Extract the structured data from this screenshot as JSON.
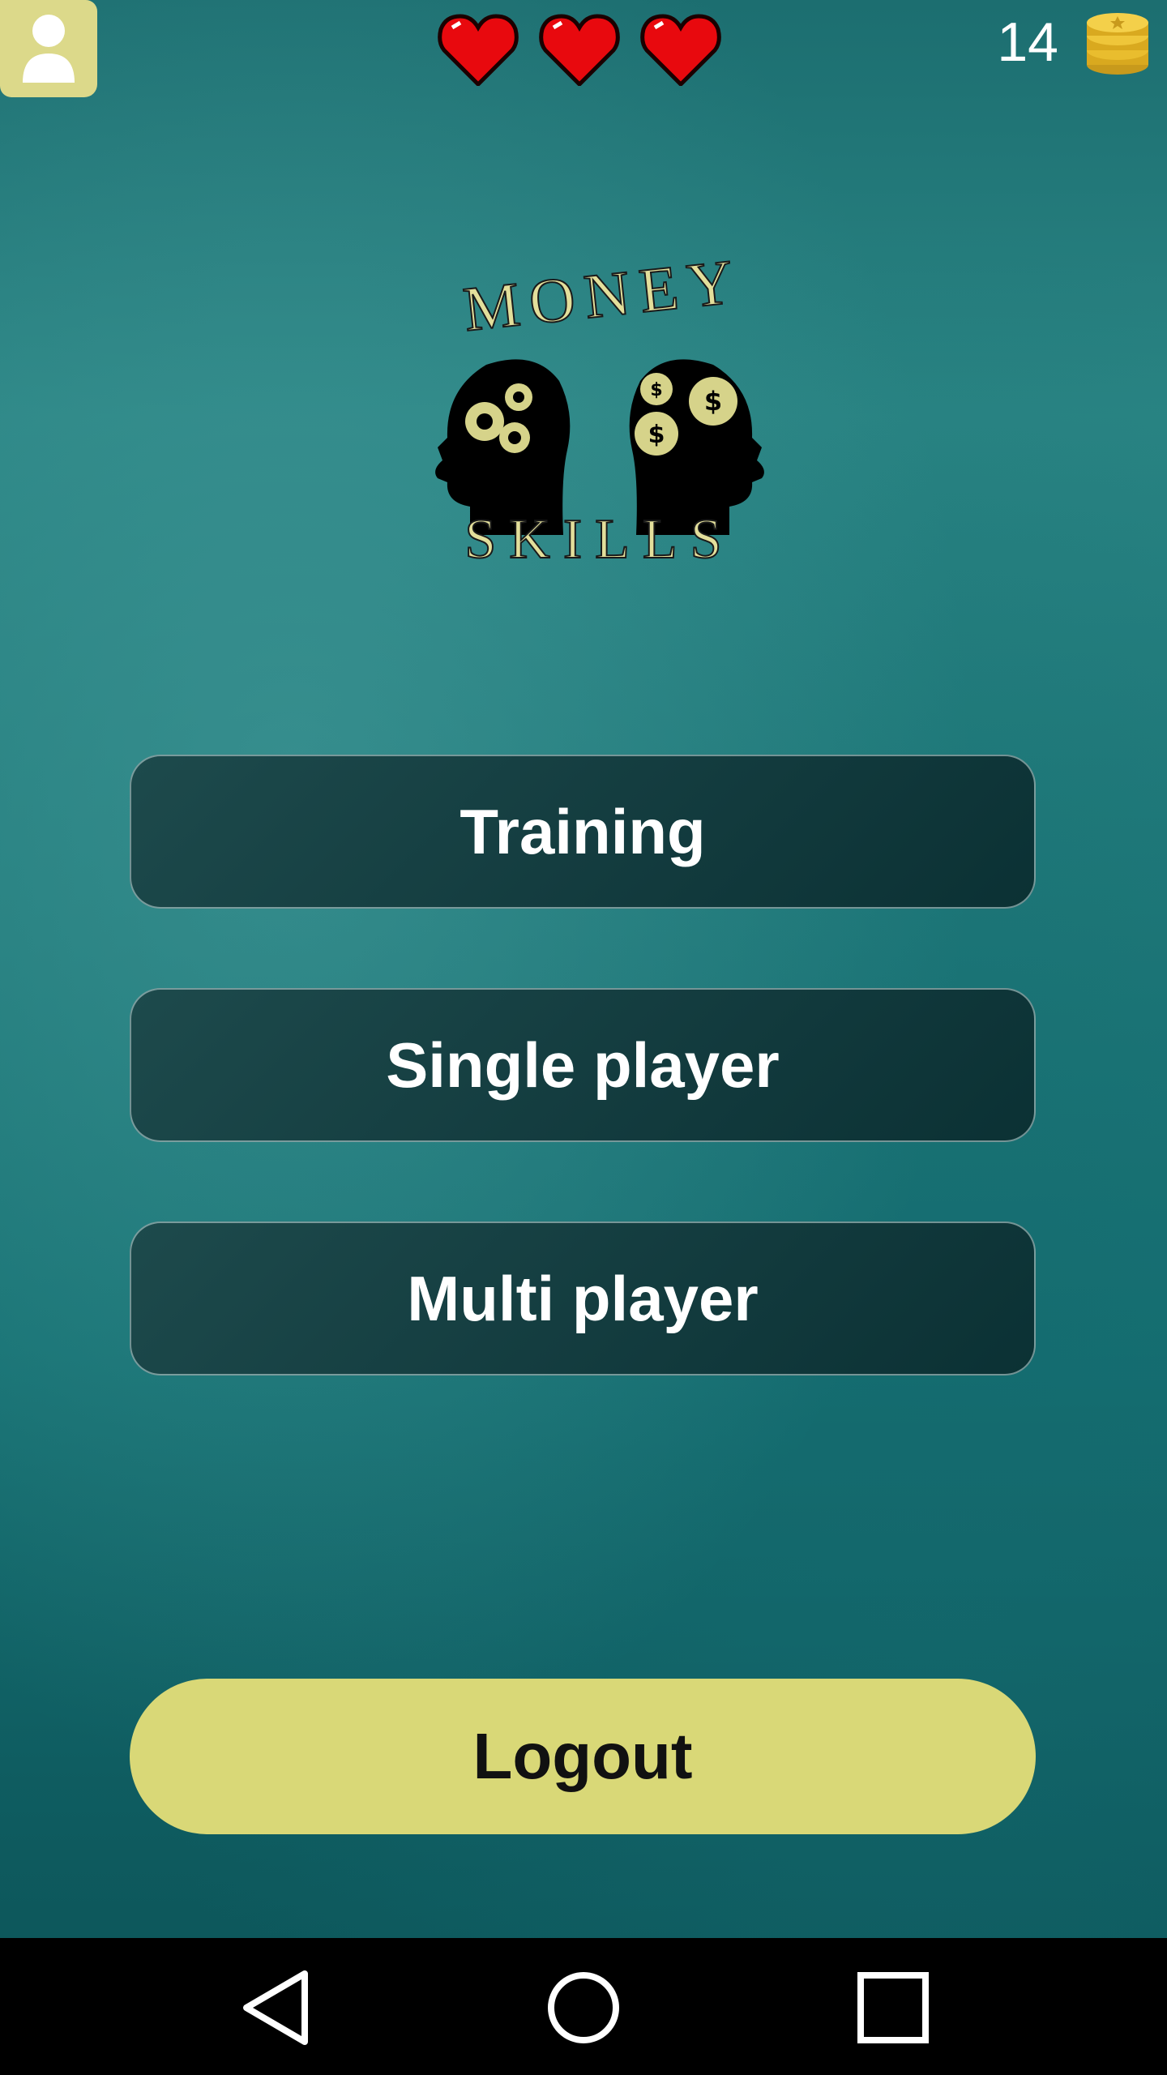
{
  "header": {
    "profile_icon": "person-icon",
    "lives": 3,
    "lives_icon": "heart-icon",
    "coin_count": "14",
    "coin_icon": "coin-stack-icon"
  },
  "logo": {
    "top_word": "MONEY",
    "bottom_word": "SKILLS"
  },
  "menu": {
    "training_label": "Training",
    "single_label": "Single player",
    "multi_label": "Multi player"
  },
  "logout_label": "Logout",
  "nav": {
    "back_icon": "triangle-back-icon",
    "home_icon": "circle-home-icon",
    "recents_icon": "square-recents-icon"
  },
  "colors": {
    "accent": "#d9d877",
    "button_dark": "#143d40",
    "background": "#1f7a7a"
  }
}
